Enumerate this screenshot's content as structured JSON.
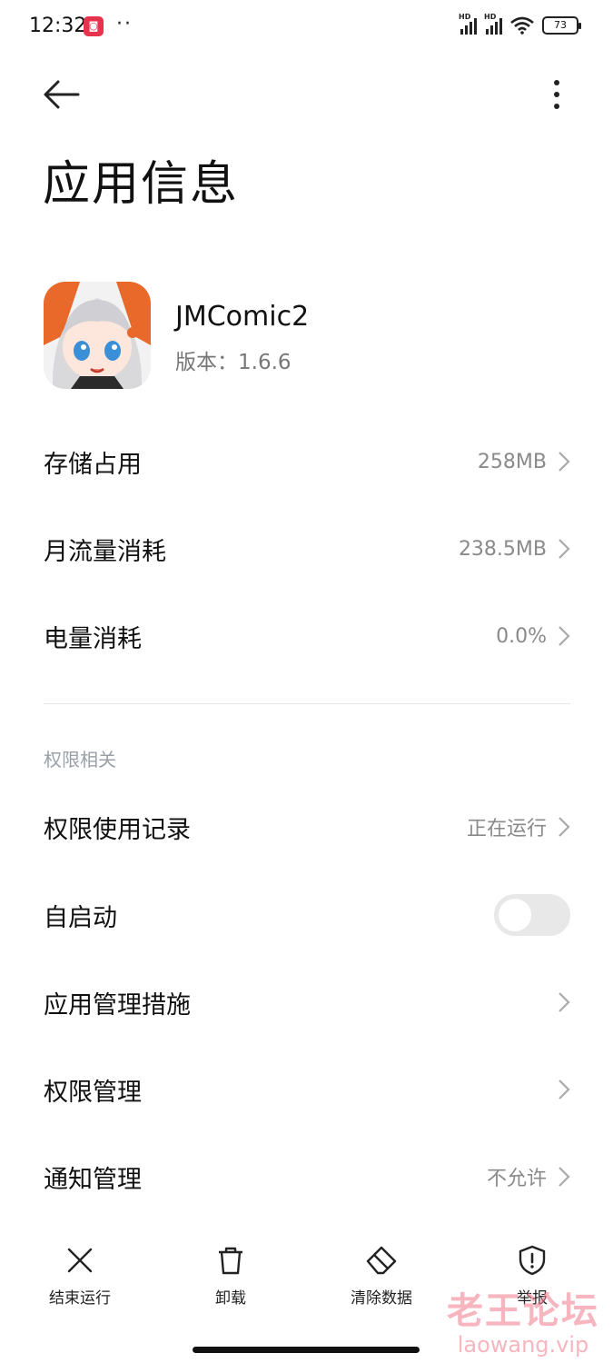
{
  "status_bar": {
    "time": "12:32",
    "dots": "··",
    "signal1_tag": "HD",
    "signal2_tag": "HD",
    "battery": "73"
  },
  "header": {
    "title": "应用信息"
  },
  "app": {
    "name": "JMComic2",
    "version": "版本：1.6.6"
  },
  "rows": {
    "storage": {
      "label": "存储占用",
      "value": "258MB"
    },
    "data": {
      "label": "月流量消耗",
      "value": "238.5MB"
    },
    "battery": {
      "label": "电量消耗",
      "value": "0.0%"
    }
  },
  "permissions": {
    "section_label": "权限相关",
    "usage": {
      "label": "权限使用记录",
      "value": "正在运行"
    },
    "autostart": {
      "label": "自启动",
      "enabled": false
    },
    "management_measures": {
      "label": "应用管理措施"
    },
    "permission_management": {
      "label": "权限管理"
    },
    "notifications": {
      "label": "通知管理",
      "value": "不允许"
    }
  },
  "actions": {
    "force_stop": "结束运行",
    "uninstall": "卸载",
    "clear_data": "清除数据",
    "report": "举报"
  },
  "watermark": {
    "cn": "老王论坛",
    "en": "laowang.vip"
  }
}
